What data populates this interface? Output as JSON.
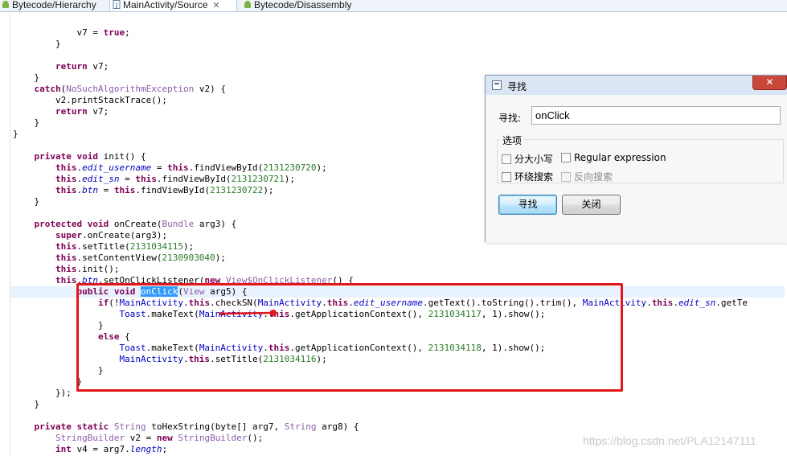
{
  "tabs": [
    {
      "label": "Bytecode/Hierarchy",
      "icon": "android-icon"
    },
    {
      "label": "MainActivity/Source",
      "icon": "java-file-icon",
      "close": "✕"
    },
    {
      "label": "Bytecode/Disassembly",
      "icon": "android-icon"
    }
  ],
  "code": {
    "l1": {
      "a": "            v7 = ",
      "b": "true",
      "c": ";"
    },
    "l2": {
      "a": "        }"
    },
    "l3": {
      "a": ""
    },
    "l4": {
      "a": "        ",
      "b": "return",
      "c": " v7;"
    },
    "l5": {
      "a": "    }"
    },
    "l6": {
      "a": "    ",
      "b": "catch",
      "c": "(",
      "d": "NoSuchAlgorithmException",
      "e": " v2) {"
    },
    "l7": {
      "a": "        v2.printStackTrace();"
    },
    "l8": {
      "a": "        ",
      "b": "return",
      "c": " v7;"
    },
    "l9": {
      "a": "    }"
    },
    "l10": {
      "a": "}"
    },
    "l11": {
      "a": ""
    },
    "l12": {
      "a": "private",
      "b": " ",
      "c": "void",
      "d": " init() {"
    },
    "l13": {
      "kw": "this",
      "dot": ".",
      "fld": "edit_username",
      "eq": " = ",
      "kw2": "this",
      "rest": ".findViewById(",
      "num": "2131230720",
      "end": ");"
    },
    "l14": {
      "kw": "this",
      "dot": ".",
      "fld": "edit_sn",
      "eq": " = ",
      "kw2": "this",
      "rest": ".findViewById(",
      "num": "2131230721",
      "end": ");"
    },
    "l15": {
      "kw": "this",
      "dot": ".",
      "fld": "btn",
      "eq": " = ",
      "kw2": "this",
      "rest": ".findViewById(",
      "num": "2131230722",
      "end": ");"
    },
    "l16": {
      "a": "}"
    },
    "l17": {
      "a": ""
    },
    "l18": {
      "a": "protected",
      "b": " ",
      "c": "void",
      "d": " onCreate(",
      "e": "Bundle",
      "f": " arg3) {"
    },
    "l19": {
      "kw": "super",
      "rest": ".onCreate(arg3);"
    },
    "l20": {
      "kw": "this",
      "rest": ".setTitle(",
      "num": "2131034115",
      "end": ");"
    },
    "l21": {
      "kw": "this",
      "rest": ".setContentView(",
      "num": "2130903040",
      "end": ");"
    },
    "l22": {
      "kw": "this",
      "rest": ".init();"
    },
    "l23": {
      "kw": "this",
      "dot": ".",
      "fld": "btn",
      "rest": ".setOnClickListener(",
      "kw2": "new",
      "sp": " ",
      "ty": "View$OnClickListener",
      "end": "() {"
    },
    "l24": {
      "kw": "public",
      "sp": " ",
      "kw2": "void",
      "sp2": " ",
      "sel": "onClick",
      "p": "(",
      "ty": "View",
      "end": " arg5) {"
    },
    "l25": {
      "kw": "if",
      "a": "(!",
      "cls": "MainActivity",
      "dot": ".",
      "kw2": "this",
      "b": ".checkSN(",
      "cls2": "MainActivity",
      "dot2": ".",
      "kw3": "this",
      "dot3": ".",
      "fld": "edit_username",
      "c": ".getText().toString().trim(), ",
      "cls3": "MainActivity",
      "dot4": ".",
      "kw4": "this",
      "dot5": ".",
      "fld2": "edit_sn",
      "d": ".getTe"
    },
    "l26": {
      "ty": "Toast",
      "a": ".makeText(",
      "cls": "MainActivity",
      "dot": ".",
      "kw": "this",
      "b": ".getApplicationContext(), ",
      "num": "2131034117",
      "c": ", 1).show();"
    },
    "l27": {
      "a": "}"
    },
    "l28": {
      "kw": "else",
      "a": " {"
    },
    "l29": {
      "ty": "Toast",
      "a": ".makeText(",
      "cls": "MainActivity",
      "dot": ".",
      "kw": "this",
      "b": ".getApplicationContext(), ",
      "num": "2131034118",
      "c": ", 1).show();"
    },
    "l30": {
      "cls": "MainActivity",
      "dot": ".",
      "kw": "this",
      "a": ".setTitle(",
      "num": "2131034116",
      "c": ");"
    },
    "l31": {
      "a": "}"
    },
    "l32": {
      "a": "}"
    },
    "l33": {
      "a": "});"
    },
    "l34": {
      "a": "}"
    },
    "l35": {
      "a": ""
    },
    "l36": {
      "kw": "private",
      "sp": " ",
      "kw2": "static",
      "sp2": " ",
      "ty": "String",
      "rest": " toHexString(byte[] arg7, ",
      "ty2": "String",
      "end": " arg8) {"
    },
    "l37": {
      "ty": "StringBuilder",
      "a": " v2 = ",
      "kw": "new",
      "sp": " ",
      "ty2": "StringBuilder",
      "end": "();"
    },
    "l38": {
      "kw": "int",
      "a": " v4 = arg7.",
      "fld": "length",
      "end": ";"
    }
  },
  "find_dialog": {
    "title": "寻找",
    "close_glyph": "✕",
    "find_label": "寻找:",
    "find_value": "onClick",
    "options_label": "选项",
    "opt_case": "分大小写",
    "opt_regex": "Regular expression",
    "opt_wrap": "环绕搜索",
    "opt_reverse": "反向搜索",
    "find_button": "寻找",
    "close_button": "关闭"
  },
  "watermark": "https://blog.csdn.net/PLA12147111",
  "colors": {
    "annotation": "#e3161b",
    "selection": "#3399ff",
    "keyword": "#7f0055"
  }
}
